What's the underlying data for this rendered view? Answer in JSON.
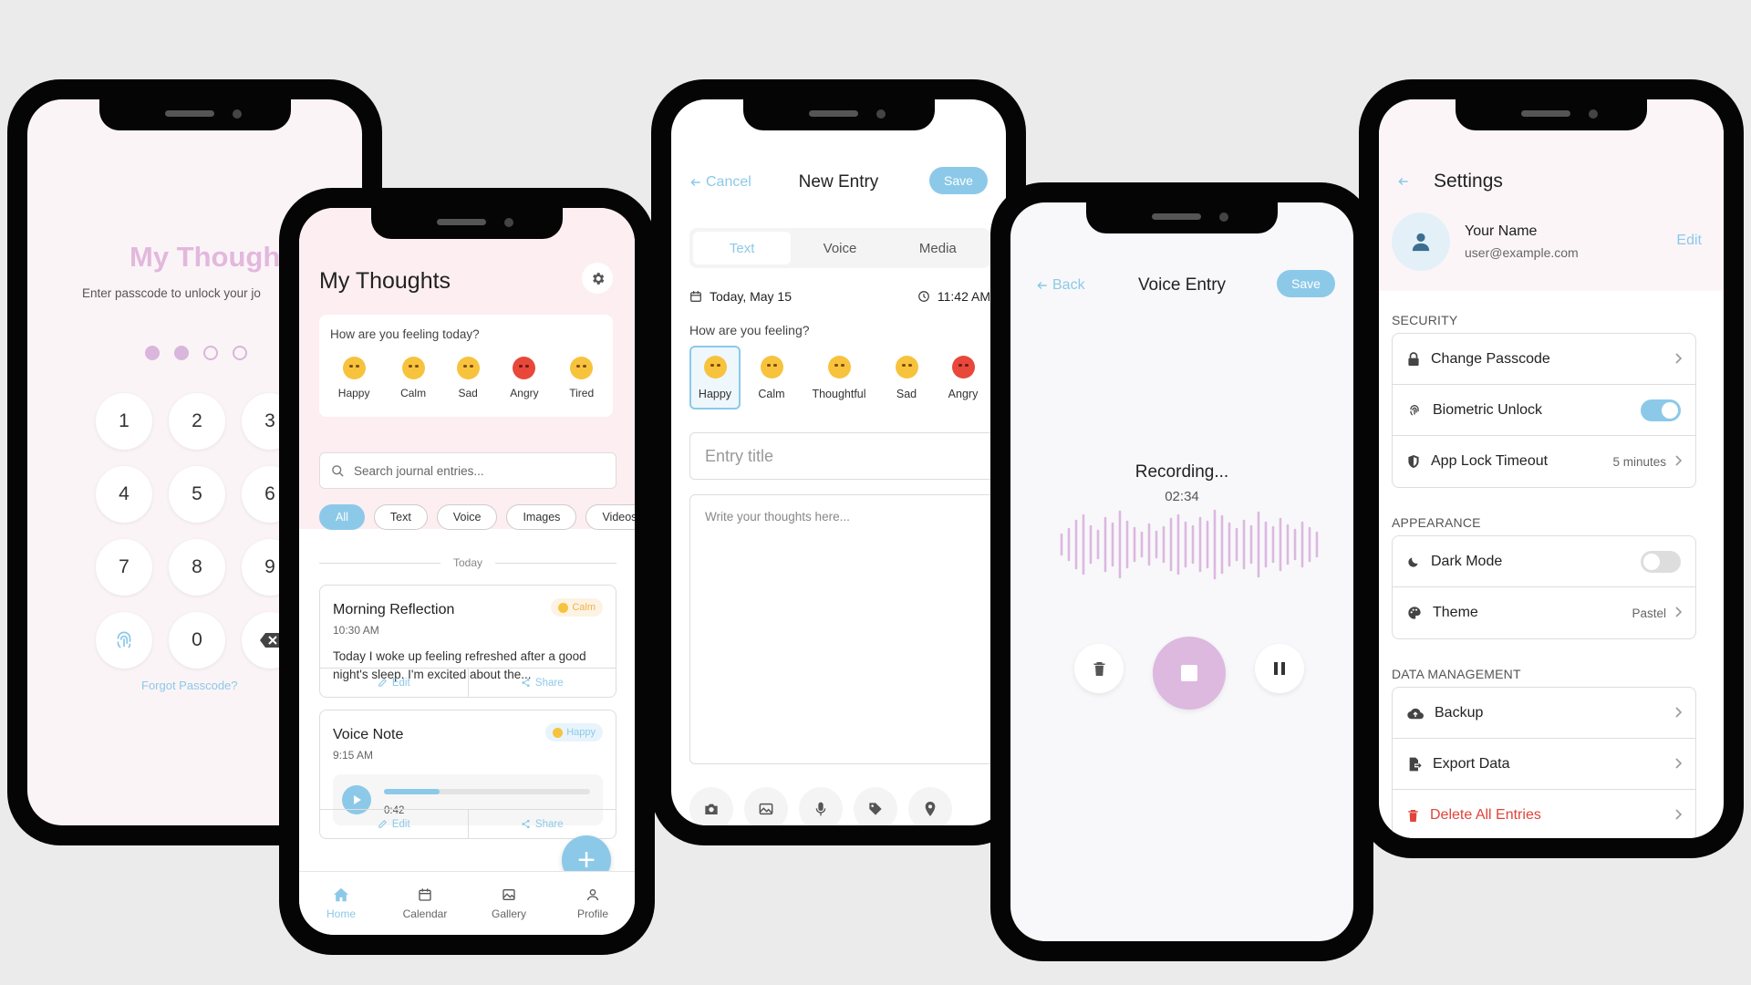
{
  "colors": {
    "accent": "#8cc9e8",
    "pink_bg": "#fdeef1",
    "lavender": "#ddb8df",
    "danger": "#e0443a"
  },
  "lock": {
    "title": "My Thoughts",
    "subtitle": "Enter passcode to unlock your jo",
    "filled_dots": 2,
    "keys": [
      "1",
      "2",
      "3",
      "4",
      "5",
      "6",
      "7",
      "8",
      "9",
      "0"
    ],
    "forgot": "Forgot Passcode?",
    "icons": [
      "fingerprint-icon",
      "backspace-icon"
    ]
  },
  "home": {
    "title": "My Thoughts",
    "mood_question": "How are you feeling today?",
    "moods": [
      "Happy",
      "Calm",
      "Sad",
      "Angry",
      "Tired"
    ],
    "search_placeholder": "Search journal entries...",
    "filters": [
      "All",
      "Text",
      "Voice",
      "Images",
      "Videos"
    ],
    "active_filter": "All",
    "section": "Today",
    "entries": [
      {
        "title": "Morning Reflection",
        "time": "10:30 AM",
        "mood": "Calm",
        "text": "Today I woke up feeling refreshed after a good night's sleep. I'm excited about the...",
        "edit": "Edit",
        "share": "Share"
      },
      {
        "title": "Voice Note",
        "time": "9:15 AM",
        "mood": "Happy",
        "duration": "0:42",
        "progress": 0.27,
        "edit": "Edit",
        "share": "Share"
      }
    ],
    "tabs": [
      "Home",
      "Calendar",
      "Gallery",
      "Profile"
    ],
    "active_tab": "Home"
  },
  "new_entry": {
    "cancel": "Cancel",
    "title": "New Entry",
    "save": "Save",
    "modes": [
      "Text",
      "Voice",
      "Media"
    ],
    "active_mode": "Text",
    "date": "Today, May 15",
    "time": "11:42 AM",
    "feel_question": "How are you feeling?",
    "moods": [
      "Happy",
      "Calm",
      "Thoughtful",
      "Sad",
      "Angry"
    ],
    "selected_mood": "Happy",
    "title_placeholder": "Entry title",
    "body_placeholder": "Write your thoughts here...",
    "tools": [
      "camera-icon",
      "image-icon",
      "mic-icon",
      "tag-icon",
      "location-icon"
    ]
  },
  "voice": {
    "back": "Back",
    "title": "Voice Entry",
    "save": "Save",
    "status": "Recording...",
    "elapsed": "02:34",
    "controls": [
      "trash-icon",
      "stop-icon",
      "pause-icon"
    ]
  },
  "settings": {
    "title": "Settings",
    "name": "Your Name",
    "email": "user@example.com",
    "edit": "Edit",
    "security_label": "SECURITY",
    "change_passcode": "Change Passcode",
    "biometric": "Biometric Unlock",
    "biometric_on": true,
    "timeout": "App Lock Timeout",
    "timeout_value": "5 minutes",
    "appearance_label": "APPEARANCE",
    "dark_mode": "Dark Mode",
    "dark_mode_on": false,
    "theme": "Theme",
    "theme_value": "Pastel",
    "data_label": "DATA MANAGEMENT",
    "backup": "Backup",
    "export": "Export Data",
    "delete": "Delete All Entries"
  }
}
